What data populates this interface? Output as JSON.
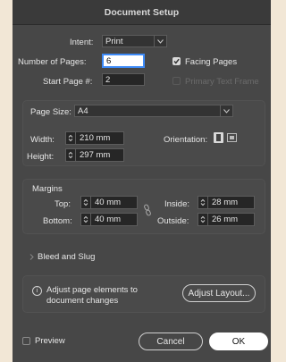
{
  "window": {
    "title": "Document Setup"
  },
  "intent": {
    "label": "Intent:",
    "value": "Print"
  },
  "pages": {
    "label": "Number of Pages:",
    "value": "6"
  },
  "start_page": {
    "label": "Start Page #:",
    "value": "2"
  },
  "facing_pages": {
    "label": "Facing Pages",
    "checked": true
  },
  "primary_text_frame": {
    "label": "Primary Text Frame",
    "checked": false,
    "enabled": false
  },
  "page_size": {
    "label": "Page Size:",
    "value": "A4"
  },
  "width": {
    "label": "Width:",
    "value": "210 mm"
  },
  "height": {
    "label": "Height:",
    "value": "297 mm"
  },
  "orientation": {
    "label": "Orientation:",
    "selected": "portrait"
  },
  "margins": {
    "title": "Margins",
    "top": {
      "label": "Top:",
      "value": "40 mm"
    },
    "bottom": {
      "label": "Bottom:",
      "value": "40 mm"
    },
    "inside": {
      "label": "Inside:",
      "value": "28 mm"
    },
    "outside": {
      "label": "Outside:",
      "value": "26 mm"
    }
  },
  "bleed_slug": {
    "label": "Bleed and Slug",
    "expanded": false
  },
  "info": {
    "line1": "Adjust page elements to",
    "line2": "document changes",
    "button": "Adjust Layout..."
  },
  "preview": {
    "label": "Preview",
    "checked": false
  },
  "buttons": {
    "cancel": "Cancel",
    "ok": "OK"
  },
  "colors": {
    "dialog_bg": "#474747",
    "titlebar_bg": "#3a3a3a",
    "focus_ring": "#3d8af7",
    "page_bg": "#f2e7d6"
  }
}
